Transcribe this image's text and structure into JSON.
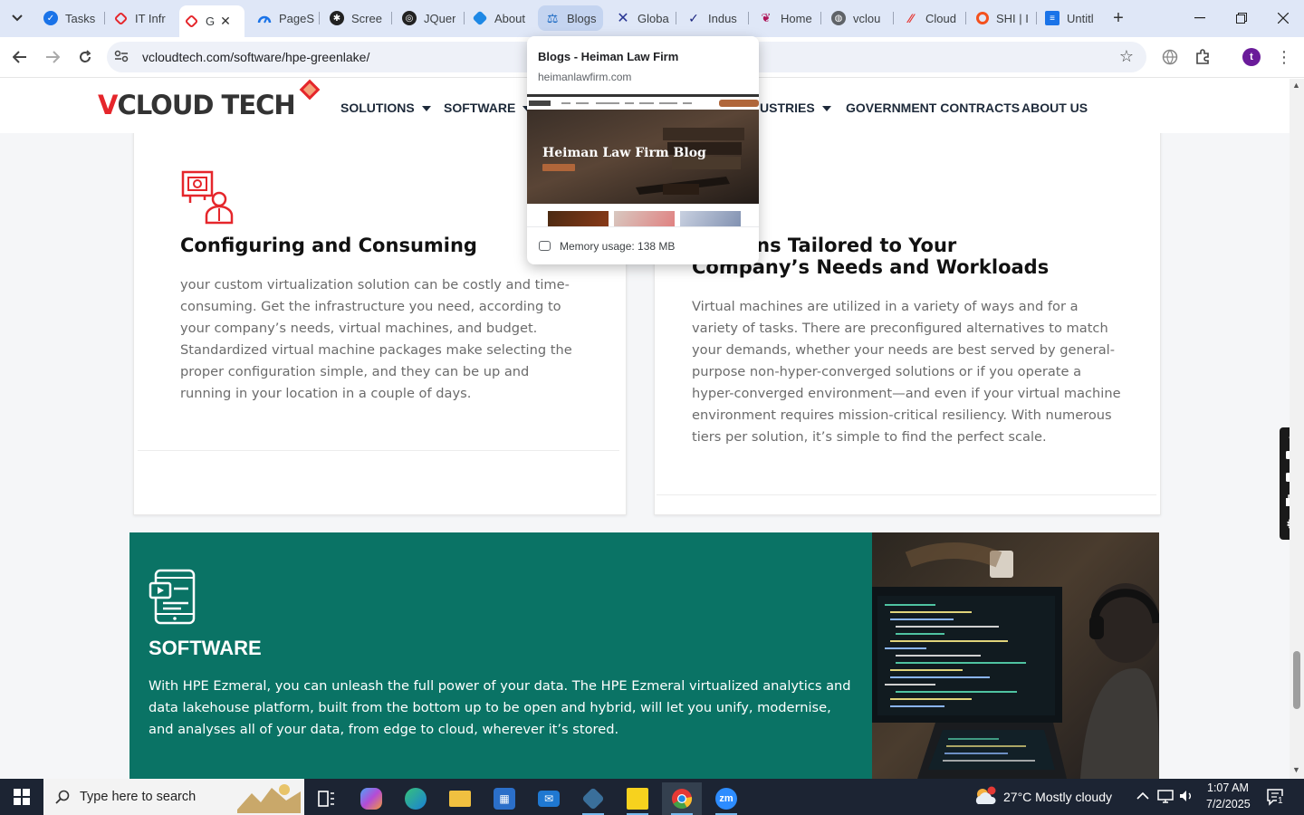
{
  "browser": {
    "tabs": [
      {
        "label": "Tasks",
        "icon": "tasks-favicon",
        "color": "#1a73e8"
      },
      {
        "label": "IT Infr",
        "icon": "vcloud-favicon",
        "color": "#e5262b"
      },
      {
        "label": "G",
        "icon": "vcloud-favicon",
        "color": "#e5262b",
        "active": true
      },
      {
        "label": "PageS",
        "icon": "pagespeed-favicon",
        "color": "#1a73e8"
      },
      {
        "label": "Scree",
        "icon": "screen-favicon",
        "color": "#222222"
      },
      {
        "label": "JQuer",
        "icon": "jquery-favicon",
        "color": "#222222"
      },
      {
        "label": "About",
        "icon": "about-favicon",
        "color": "#1e88e5"
      },
      {
        "label": "Blogs",
        "icon": "scales-favicon",
        "color": "#1565c0",
        "hovered": true
      },
      {
        "label": "Globa",
        "icon": "global-favicon",
        "color": "#283593"
      },
      {
        "label": "Indus",
        "icon": "industry-favicon",
        "color": "#1a237e"
      },
      {
        "label": "Home",
        "icon": "home-favicon",
        "color": "#ad1457"
      },
      {
        "label": "vclou",
        "icon": "globe-favicon",
        "color": "#5f6368"
      },
      {
        "label": "Cloud",
        "icon": "cloud-favicon",
        "color": "#e53935"
      },
      {
        "label": "SHI | I",
        "icon": "shi-favicon",
        "color": "#f4511e"
      },
      {
        "label": "Untitl",
        "icon": "docs-favicon",
        "color": "#1a73e8"
      }
    ],
    "url": "vcloudtech.com/software/hpe-greenlake/",
    "profile_initial": "t",
    "hover_card": {
      "title": "Blogs - Heiman Law Firm",
      "domain": "heimanlawfirm.com",
      "preview_title": "Heiman Law Firm Blog",
      "memory": "Memory usage: 138 MB"
    }
  },
  "site": {
    "logo_v": "V",
    "logo_rest": "CLOUD TECH",
    "menu": [
      {
        "label": "SOLUTIONS",
        "dropdown": true
      },
      {
        "label": "SOFTWARE",
        "dropdown": true
      },
      {
        "label": "USTRIES",
        "dropdown": true
      },
      {
        "label": "GOVERNMENT CONTRACTS",
        "dropdown": false
      },
      {
        "label": "ABOUT US",
        "dropdown": false
      }
    ],
    "card_left": {
      "title": "Configuring and Consuming",
      "body": "your custom virtualization solution can be costly and time-consuming. Get the infrastructure you need, according to your company’s needs, virtual machines, and budget. Standardized virtual machine packages make selecting the proper configuration simple, and they can be up and running in your location in a couple of days."
    },
    "card_right": {
      "title": "urations Tailored to Your Company’s Needs and Workloads",
      "body": "Virtual machines are utilized in a variety of ways and for a variety of tasks. There are preconfigured alternatives to match your demands, whether your needs are best served by general-purpose non-hyper-converged solutions or if you operate a hyper-converged environment—and even if your virtual machine environment requires mission-critical resiliency. With numerous tiers per solution, it’s simple to find the perfect scale."
    },
    "software": {
      "title": "SOFTWARE",
      "body": "With HPE Ezmeral, you can unleash the full power of your data. The HPE Ezmeral virtualized analytics and data lakehouse platform, built from the bottom up to be open and hybrid, will let you unify, modernise, and analyses all of your data, from edge to cloud, wherever it’s stored."
    },
    "colors": {
      "brand_red": "#e5262b",
      "teal": "#0a7365",
      "nav_text": "#1e2a3a"
    }
  },
  "taskbar": {
    "search_placeholder": "Type here to search",
    "weather": "27°C  Mostly cloudy",
    "time": "1:07 AM",
    "date": "7/2/2025",
    "notification_count": "1"
  }
}
